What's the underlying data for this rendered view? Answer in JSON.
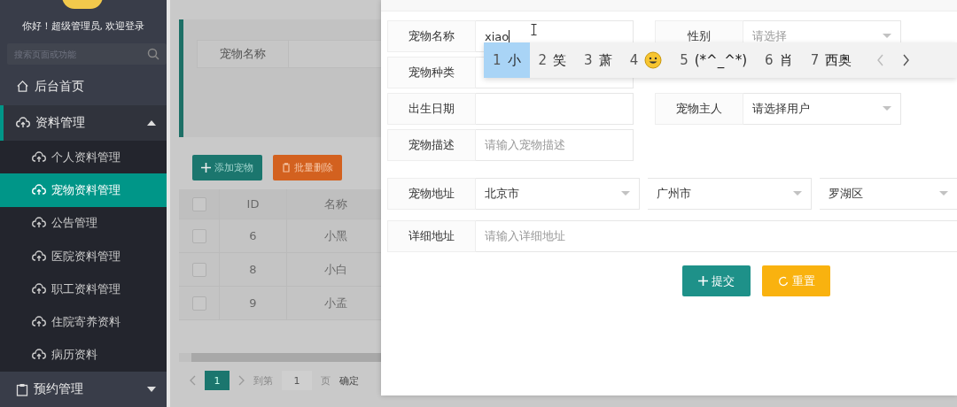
{
  "sidebar": {
    "greeting": "你好！超级管理员, 欢迎登录",
    "search": {
      "placeholder": "搜索页面或功能"
    },
    "items": [
      {
        "kind": "link",
        "label": "后台首页"
      },
      {
        "kind": "group",
        "label": "资料管理",
        "expanded": true,
        "children": [
          {
            "label": "个人资料管理",
            "selected": false
          },
          {
            "label": "宠物资料管理",
            "selected": true
          },
          {
            "label": "公告管理",
            "selected": false
          },
          {
            "label": "医院资料管理",
            "selected": false
          },
          {
            "label": "职工资料管理",
            "selected": false
          },
          {
            "label": "住院寄养资料",
            "selected": false
          },
          {
            "label": "病历资料",
            "selected": false
          }
        ]
      },
      {
        "kind": "group",
        "label": "预约管理",
        "expanded": false
      }
    ]
  },
  "search_panel": {
    "fields": [
      {
        "label": "宠物名称"
      }
    ]
  },
  "toolbar": [
    {
      "kind": "add",
      "label": "添加宠物"
    },
    {
      "kind": "delete",
      "label": "批量删除"
    }
  ],
  "table": {
    "header_checked": false,
    "columns": [
      "ID",
      "名称"
    ],
    "rows": [
      {
        "checked": false,
        "cells": [
          "6",
          "小黑"
        ]
      },
      {
        "checked": false,
        "cells": [
          "8",
          "小白"
        ]
      },
      {
        "checked": false,
        "cells": [
          "9",
          "小孟"
        ]
      }
    ]
  },
  "pagination": {
    "pages": [
      {
        "label": "1",
        "selected": true
      }
    ],
    "goto_label": "到第",
    "page_input": "1",
    "page_unit": "页",
    "confirm": "确定"
  },
  "modal": {
    "rows": [
      [
        {
          "label": "宠物名称",
          "kind": "input",
          "value": "xiao"
        },
        {
          "label": "性别",
          "kind": "select",
          "placeholder": "请选择"
        }
      ],
      [
        {
          "label": "宠物种类",
          "kind": "input"
        },
        {
          "kind": "blank"
        }
      ],
      [
        {
          "label": "出生日期",
          "kind": "input"
        },
        {
          "label": "宠物主人",
          "kind": "select",
          "value": "请选择用户"
        }
      ],
      [
        {
          "label": "宠物描述",
          "kind": "input",
          "placeholder": "请输入宠物描述"
        }
      ]
    ],
    "address": {
      "label": "宠物地址",
      "selects": [
        "北京市",
        "广州市",
        "罗湖区"
      ]
    },
    "detail": {
      "label": "详细地址",
      "placeholder": "请输入详细地址"
    },
    "buttons": [
      {
        "kind": "submit",
        "label": "提交"
      },
      {
        "kind": "reset",
        "label": "重置"
      }
    ]
  },
  "ime": {
    "candidates": [
      {
        "number": "1",
        "kind": "text",
        "text": "小",
        "selected": true
      },
      {
        "number": "2",
        "kind": "text",
        "text": "笑",
        "selected": false
      },
      {
        "number": "3",
        "kind": "text",
        "text": "萧",
        "selected": false
      },
      {
        "number": "4",
        "kind": "emoji",
        "selected": false
      },
      {
        "number": "5",
        "kind": "text",
        "text": "(*^_^*)",
        "selected": false
      },
      {
        "number": "6",
        "kind": "text",
        "text": "肖",
        "selected": false
      },
      {
        "number": "7",
        "kind": "text",
        "text": "西奥",
        "selected": false
      }
    ]
  }
}
